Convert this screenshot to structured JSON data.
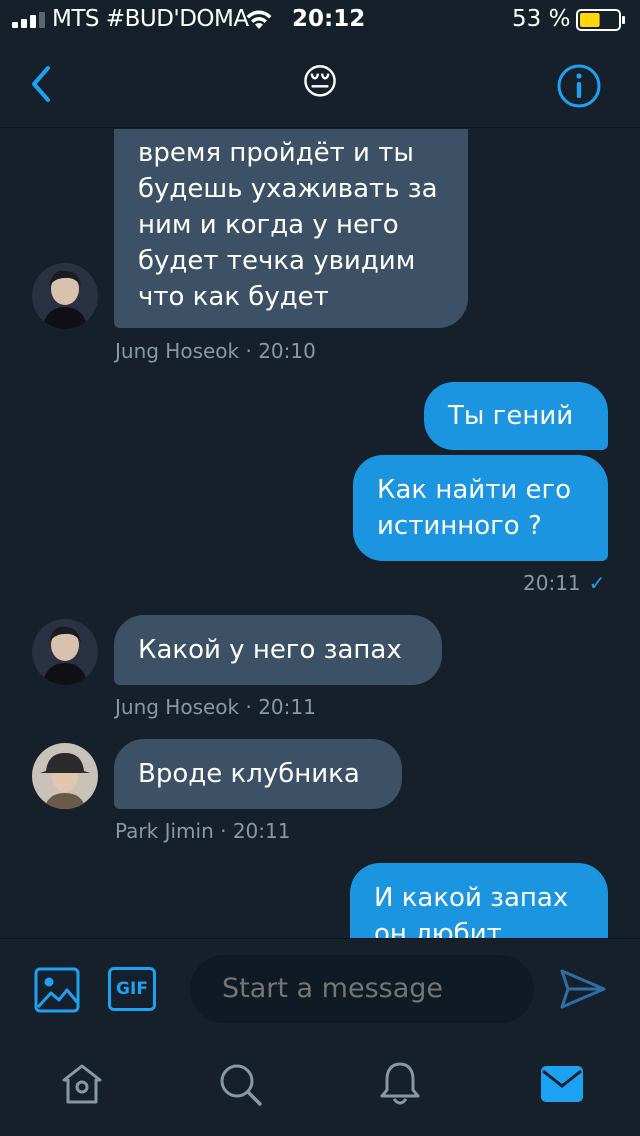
{
  "status_bar": {
    "carrier": "MTS #BUD'DOMA",
    "time": "20:12",
    "battery": "53 %",
    "battery_level": 0.53
  },
  "header": {
    "emoji": "😔",
    "back_icon": "chevron-left-icon",
    "info_icon": "info-circle-icon"
  },
  "messages": [
    {
      "direction": "in",
      "text": "время пройдёт и ты\nбудешь ухаживать за\nним и когда у него\nбудет течка увидим\nчто как будет"
    },
    {
      "direction": "out",
      "text": "Ты гений"
    },
    {
      "direction": "out",
      "text": "Как найти его\nистинного ?"
    },
    {
      "direction": "in",
      "text": "Какой у него запах"
    },
    {
      "direction": "in",
      "text": "Вроде клубника"
    },
    {
      "direction": "out",
      "text": "И какой запах\nон любит"
    }
  ],
  "meta": {
    "m1": "Jung Hoseok · 20:10",
    "m2": "20:11",
    "m3": "Jung Hoseok · 20:11",
    "m4": "Park Jimin · 20:11"
  },
  "composer": {
    "gif_label": "GIF",
    "placeholder": "Start a message",
    "send_icon": "send-icon"
  },
  "tabs": [
    "home-icon",
    "search-icon",
    "bell-icon",
    "mail-icon"
  ],
  "colors": {
    "background": "#15202b",
    "incoming_bubble": "#3d5166",
    "outgoing_bubble": "#1b95e0",
    "accent": "#1da1f2",
    "meta_text": "#8899a6"
  }
}
